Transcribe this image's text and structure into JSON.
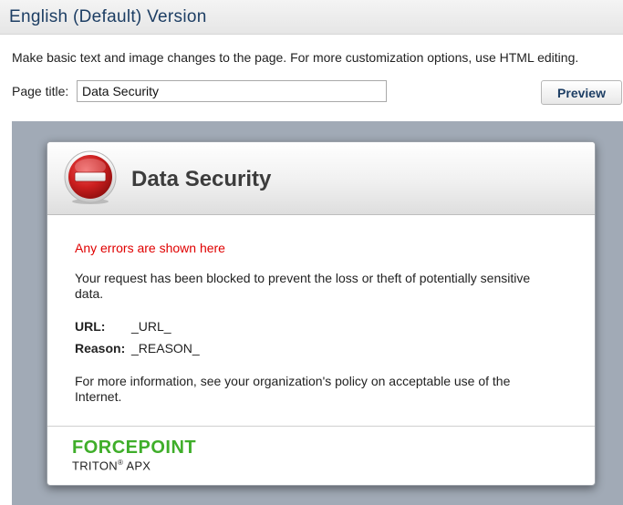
{
  "header": {
    "title": "English (Default) Version"
  },
  "instructions": "Make basic text and image changes to the page. For more customization options, use HTML editing.",
  "page_title_field": {
    "label": "Page title:",
    "value": "Data Security"
  },
  "toolbar": {
    "preview_label": "Preview"
  },
  "block_page": {
    "title": "Data Security",
    "icon": "stop-icon",
    "error_text": "Any errors are shown here",
    "message": "Your request has been blocked to prevent the loss or theft of potentially sensitive data.",
    "url_label": "URL:",
    "url_value": "_URL_",
    "reason_label": "Reason:",
    "reason_value": "_REASON_",
    "info_text": "For more information, see your organization's policy on acceptable use of the Internet.",
    "brand": "FORCEPOINT",
    "product": "TRITON",
    "product_mark": "®",
    "product_suffix": " APX"
  },
  "colors": {
    "header_text": "#1d3e64",
    "error_text": "#e00000",
    "brand_green": "#3fae2a",
    "preview_background": "#a1aab6",
    "stop_red": "#cc1f1f"
  }
}
